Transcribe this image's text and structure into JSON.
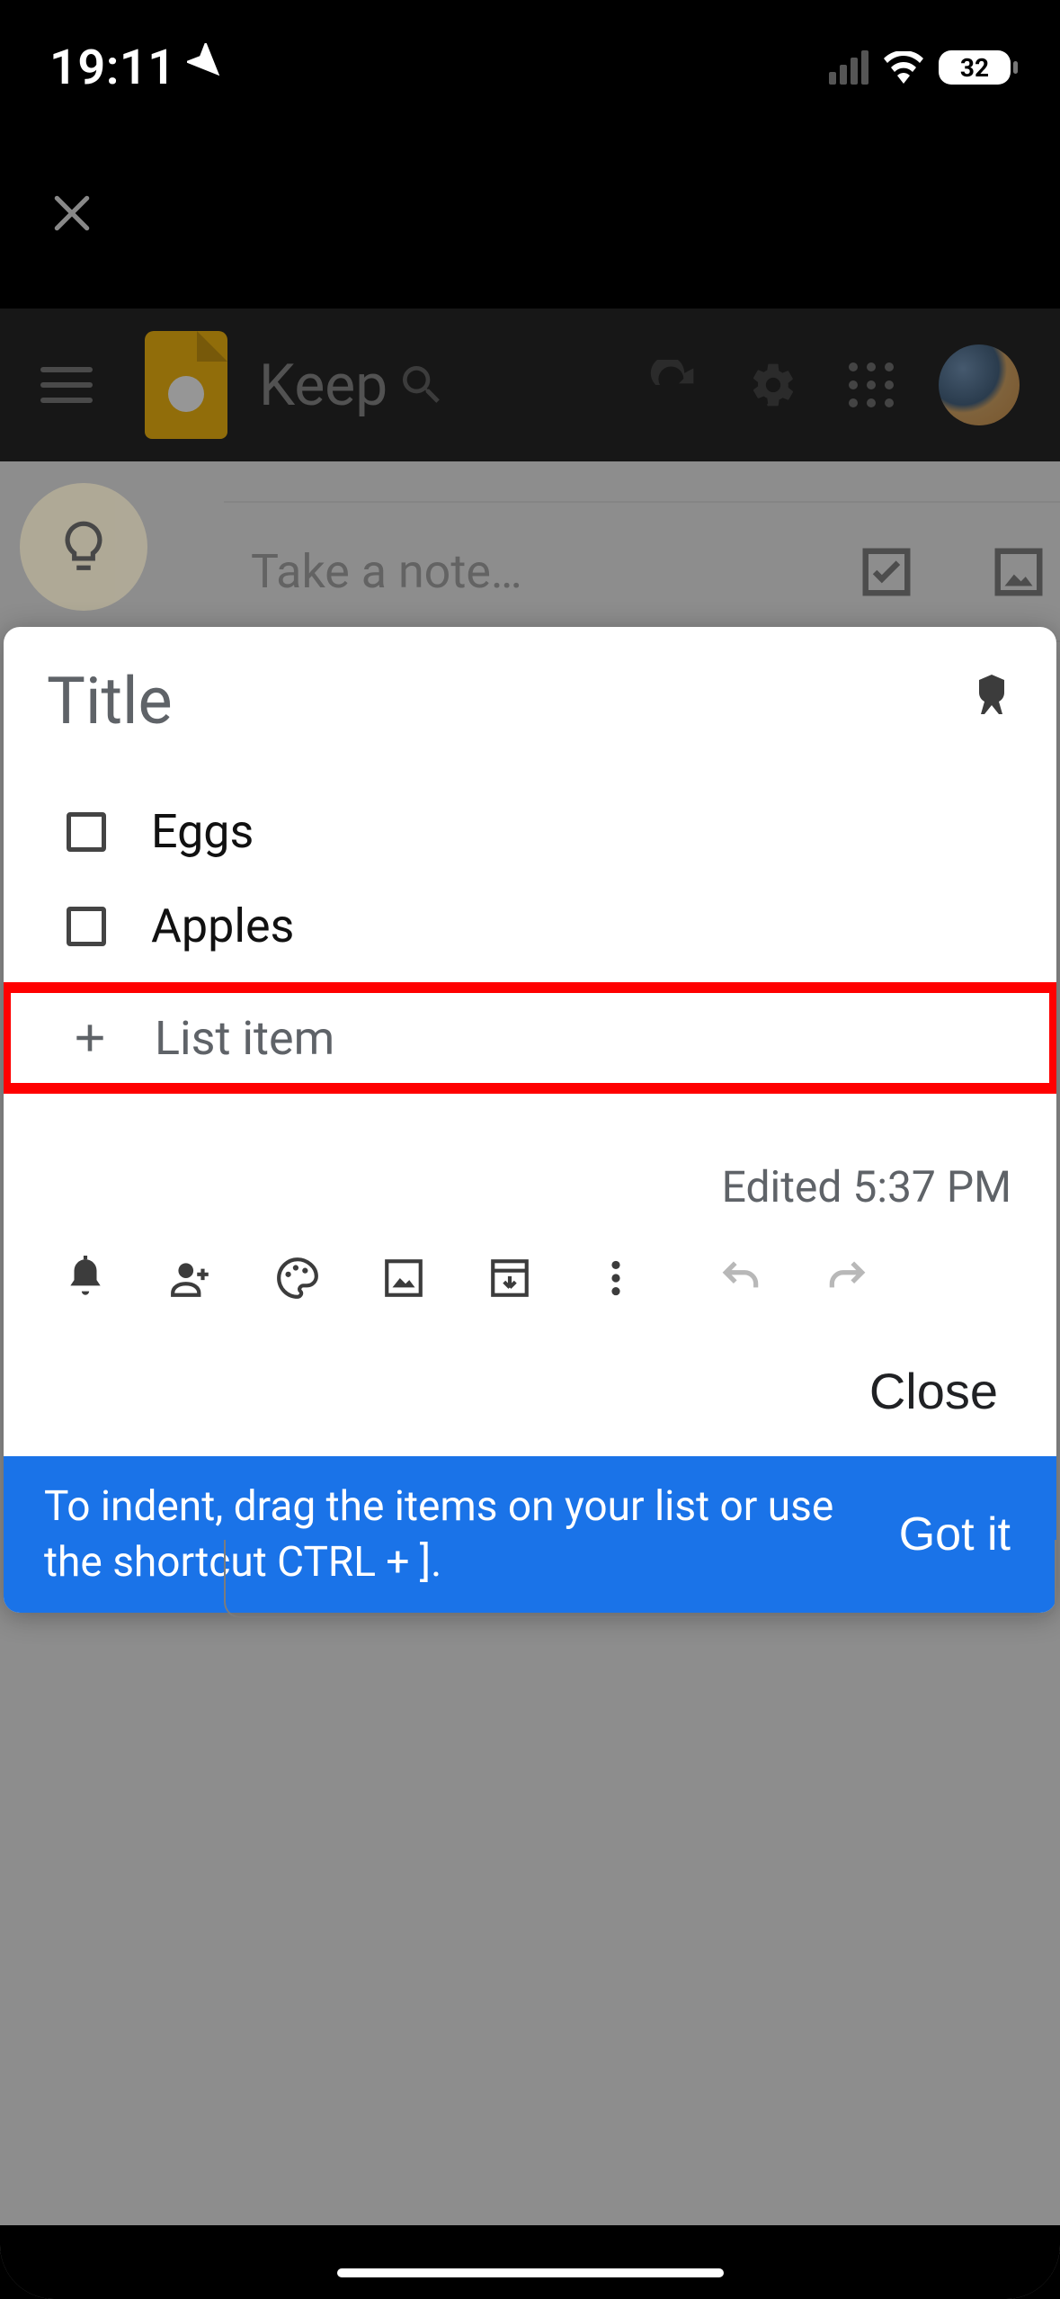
{
  "status_bar": {
    "time": "19:11",
    "battery": "32"
  },
  "top": {
    "app_name": "Keep"
  },
  "take_note": {
    "placeholder": "Take a note…"
  },
  "note": {
    "title_placeholder": "Title",
    "items": [
      {
        "text": "Eggs",
        "checked": false
      },
      {
        "text": "Apples",
        "checked": false
      }
    ],
    "add_item_label": "List item",
    "edited_label": "Edited 5:37 PM",
    "close_label": "Close"
  },
  "tip": {
    "text": "To indent, drag the items on your list or use the shortcut CTRL + ].",
    "button": "Got it"
  },
  "colors": {
    "accent": "#1a73e8",
    "highlight": "#ff0000",
    "keep_yellow": "#f5b400"
  }
}
